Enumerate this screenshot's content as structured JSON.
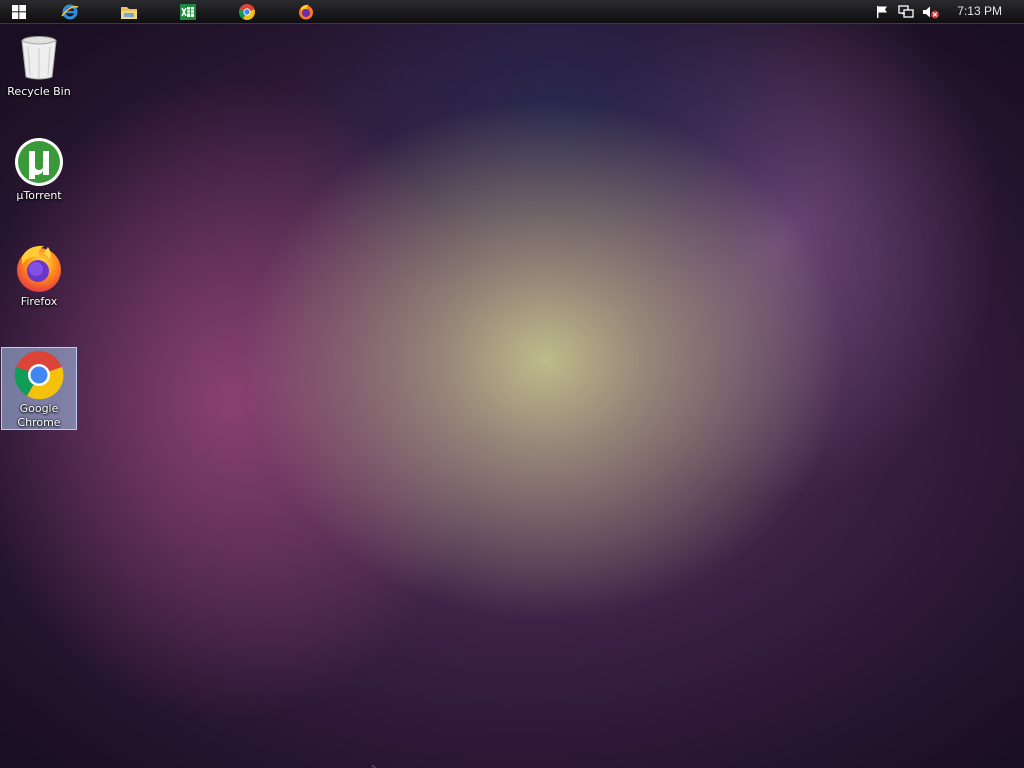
{
  "taskbar": {
    "pinned": [
      {
        "name": "start",
        "icon": "windows-logo-icon"
      },
      {
        "name": "internet-explorer",
        "icon": "internet-explorer-icon"
      },
      {
        "name": "file-explorer",
        "icon": "folder-icon"
      },
      {
        "name": "excel",
        "icon": "spreadsheet-icon"
      },
      {
        "name": "chrome",
        "icon": "chrome-icon"
      },
      {
        "name": "firefox",
        "icon": "firefox-icon"
      }
    ],
    "tray": [
      {
        "name": "action-center",
        "icon": "flag-icon"
      },
      {
        "name": "network",
        "icon": "network-icon"
      },
      {
        "name": "volume",
        "icon": "volume-muted-icon"
      }
    ],
    "clock": "7:13 PM"
  },
  "desktop": {
    "icons": [
      {
        "label": "Recycle Bin",
        "icon": "recycle-bin-icon",
        "selected": false
      },
      {
        "label": "µTorrent",
        "icon": "utorrent-icon",
        "selected": false
      },
      {
        "label": "Firefox",
        "icon": "firefox-icon",
        "selected": false
      },
      {
        "label": "Google Chrome",
        "icon": "chrome-icon",
        "selected": true
      }
    ]
  },
  "colors": {
    "taskbar_bg": "#1a1a1d",
    "selection": "#aac8f0",
    "utorrent_green": "#3a9a3a"
  }
}
